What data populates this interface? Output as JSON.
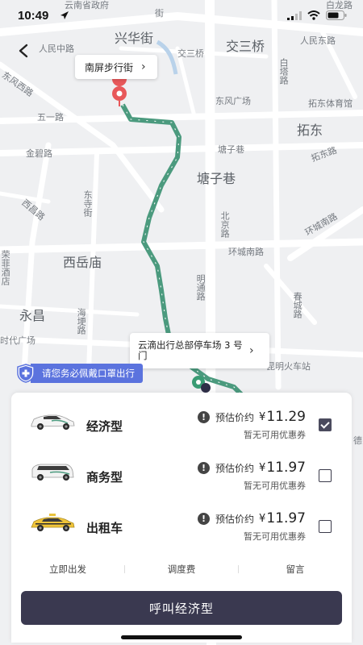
{
  "status_bar": {
    "time": "10:49"
  },
  "map": {
    "labels": [
      "云南省政府",
      "兴华街",
      "交三桥",
      "人民东路",
      "人民中路",
      "交三桥",
      "白塔路",
      "东风西路",
      "五一路",
      "东风广场",
      "拓东体育馆",
      "拓东",
      "塘子巷",
      "拓东路",
      "金碧路",
      "塘子巷",
      "西昌路",
      "东寺街",
      "北京路",
      "环城南路",
      "西岳庙",
      "环城南路",
      "明通路",
      "永昌",
      "海埂路",
      "春城路",
      "时代广场",
      "昆明火车站",
      "荣菲酒店",
      "白龙路",
      "德",
      "街"
    ]
  },
  "callouts": {
    "destination": "南屏步行街",
    "origin": "云滴出行总部停车场 3 号门"
  },
  "mask_notice": "请您务必佩戴口罩出行",
  "cars": [
    {
      "name": "经济型",
      "estimate_label": "预估价约",
      "currency": "¥",
      "price": "11.29",
      "coupon": "暂无可用优惠券",
      "checked": true
    },
    {
      "name": "商务型",
      "estimate_label": "预估价约",
      "currency": "¥",
      "price": "11.97",
      "coupon": "暂无可用优惠券",
      "checked": false
    },
    {
      "name": "出租车",
      "estimate_label": "预估价约",
      "currency": "¥",
      "price": "11.97",
      "coupon": "暂无可用优惠券",
      "checked": false
    }
  ],
  "options": {
    "depart": "立即出发",
    "dispatch_fee": "调度费",
    "message": "留言"
  },
  "call_button": "呼叫经济型",
  "colors": {
    "route": "#4b9a7e",
    "accent": "#3a3950",
    "notice": "#5b73de",
    "pin": "#e8585a"
  }
}
